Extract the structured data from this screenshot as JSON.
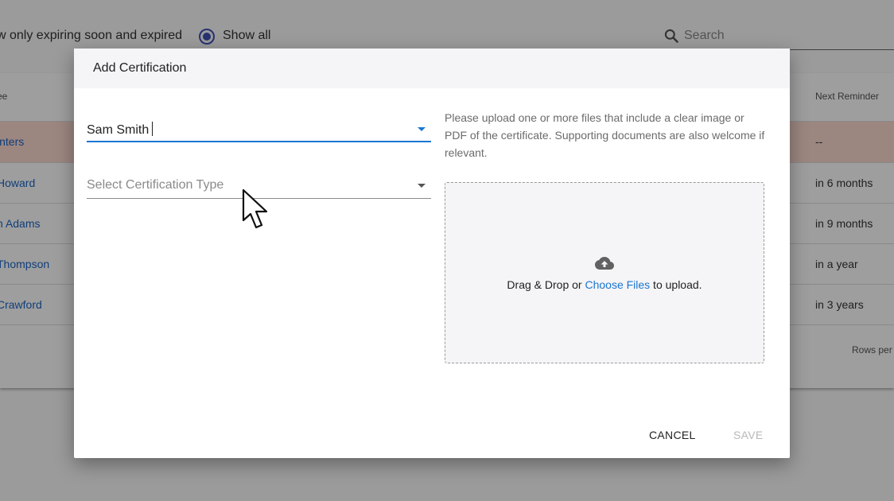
{
  "background": {
    "filter_expiring_label": "w only expiring soon and expired",
    "filter_all_label": "Show all",
    "search_placeholder": "Search",
    "columns": {
      "name_header": "ee",
      "reminder_header": "Next Reminder"
    },
    "rows": [
      {
        "name": "inters",
        "reminder": "--"
      },
      {
        "name": "Howard",
        "reminder": "in 6 months"
      },
      {
        "name": "n Adams",
        "reminder": "in 9 months"
      },
      {
        "name": "Thompson",
        "reminder": "in a year"
      },
      {
        "name": "Crawford",
        "reminder": "in 3 years"
      }
    ],
    "rows_per_page_label": "Rows per"
  },
  "dialog": {
    "title": "Add Certification",
    "person_value": "Sam Smith",
    "certification_type_placeholder": "Select Certification Type",
    "instructions": "Please upload one or more files that include a clear image or PDF of the certificate. Supporting documents are also welcome if relevant.",
    "dropzone": {
      "text_before": "Drag & Drop or ",
      "link_text": "Choose Files",
      "text_after": " to upload."
    },
    "cancel_label": "CANCEL",
    "save_label": "SAVE"
  },
  "colors": {
    "accent": "#1976d2",
    "highlight_row": "#fcd8cf",
    "radio": "#3f51b5"
  },
  "icons": [
    "search-icon",
    "radio-checked-icon",
    "dropdown-arrow-icon",
    "cloud-upload-icon",
    "mouse-cursor-icon"
  ]
}
